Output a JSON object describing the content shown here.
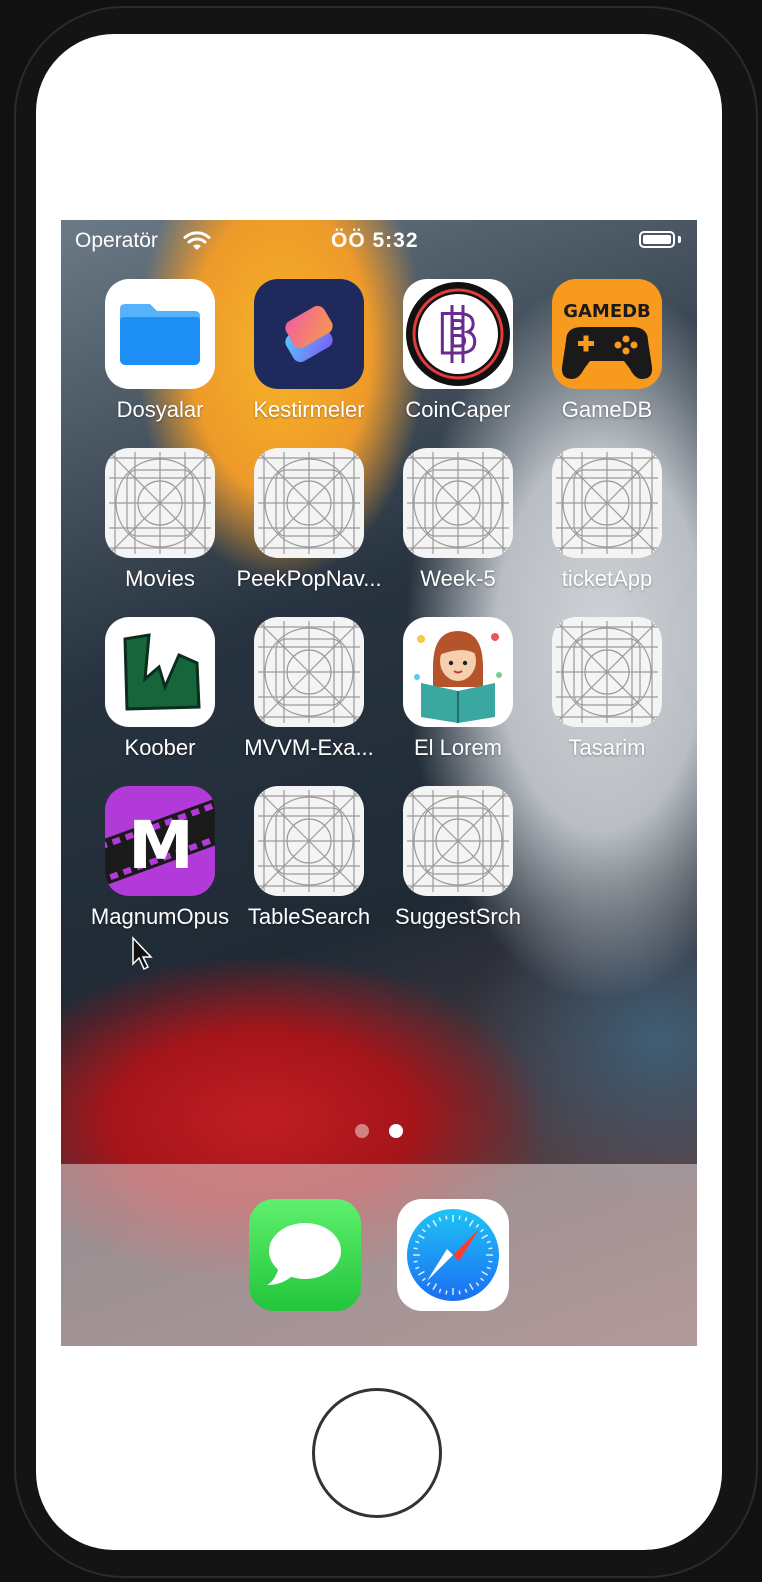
{
  "status_bar": {
    "carrier": "Operatör",
    "time": "ÖÖ 5:32"
  },
  "apps": [
    {
      "label": "Dosyalar",
      "icon": "files-folder-icon"
    },
    {
      "label": "Kestirmeler",
      "icon": "shortcuts-icon"
    },
    {
      "label": "CoinCaper",
      "icon": "bitcoin-icon"
    },
    {
      "label": "GameDB",
      "icon": "gamedb-gamepad-icon",
      "icon_text": "GAMEDB"
    },
    {
      "label": "Movies",
      "icon": "placeholder-app-icon"
    },
    {
      "label": "PeekPopNav...",
      "icon": "placeholder-app-icon"
    },
    {
      "label": "Week-5",
      "icon": "placeholder-app-icon"
    },
    {
      "label": "ticketApp",
      "icon": "placeholder-app-icon"
    },
    {
      "label": "Koober",
      "icon": "koober-icon"
    },
    {
      "label": "MVVM-Exa...",
      "icon": "placeholder-app-icon"
    },
    {
      "label": "El Lorem",
      "icon": "reading-girl-icon"
    },
    {
      "label": "Tasarim",
      "icon": "placeholder-app-icon"
    },
    {
      "label": "MagnumOpus",
      "icon": "magnumopus-film-icon",
      "icon_text": "M"
    },
    {
      "label": "TableSearch",
      "icon": "placeholder-app-icon"
    },
    {
      "label": "SuggestSrch",
      "icon": "placeholder-app-icon"
    }
  ],
  "page_indicator": {
    "count": 2,
    "current": 2
  },
  "dock": [
    {
      "name": "Messages",
      "icon": "messages-icon"
    },
    {
      "name": "Safari",
      "icon": "safari-compass-icon"
    }
  ],
  "colors": {
    "files_blue": "#1e90f5",
    "gamedb_orange": "#f79a1e",
    "magnum_purple": "#b13ad8",
    "koober_green": "#17663b",
    "messages_green": "#2fcf46",
    "safari_blue": "#1b8ef2"
  }
}
